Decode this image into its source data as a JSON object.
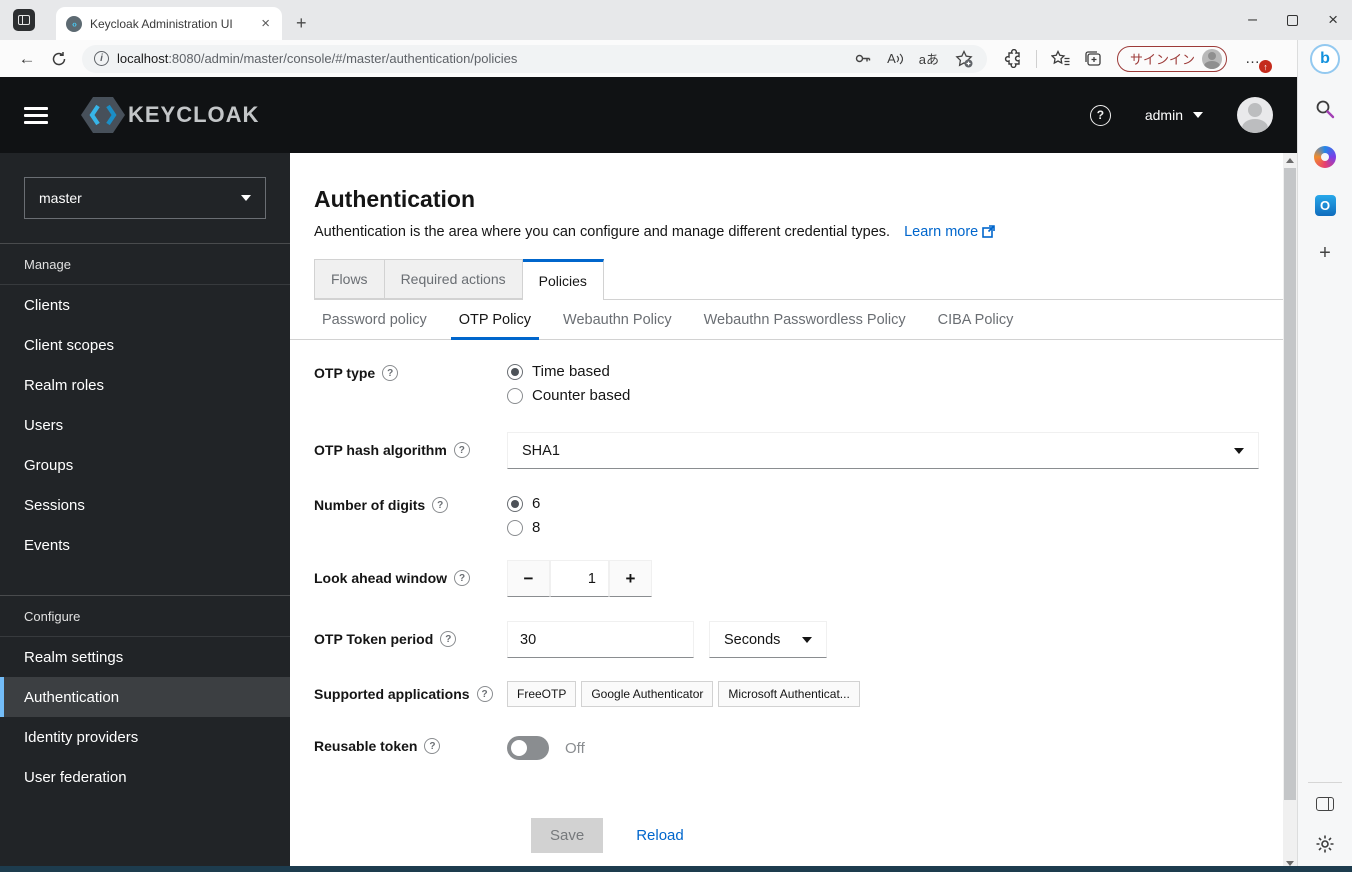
{
  "colors": {
    "accent_blue": "#0066cc",
    "selected_nav_blue": "#73bcf7",
    "masthead_bg": "#101214",
    "signin_red": "#9c3a38",
    "disabled_button_bg": "#d2d2d2"
  },
  "browser": {
    "tab_title": "Keycloak Administration UI",
    "url_host": "localhost",
    "url_rest": ":8080/admin/master/console/#/master/authentication/policies",
    "signin_label": "サインイン"
  },
  "glyphs": {
    "close": "×",
    "plus": "+",
    "minimize": "–",
    "back": "←",
    "question": "?",
    "info": "i",
    "minus": "−",
    "ellipsis": "…",
    "read_aloud": "A",
    "translate": "aあ",
    "update_arrow": "↑",
    "bing_b": "b",
    "outlook_o": "O",
    "favicon_marks": "‹›"
  },
  "masthead": {
    "brand": "KEYCLOAK",
    "username": "admin"
  },
  "sidebar": {
    "realm": "master",
    "groups": [
      {
        "label": "Manage",
        "items": [
          "Clients",
          "Client scopes",
          "Realm roles",
          "Users",
          "Groups",
          "Sessions",
          "Events"
        ]
      },
      {
        "label": "Configure",
        "items": [
          "Realm settings",
          "Authentication",
          "Identity providers",
          "User federation"
        ],
        "active_item": "Authentication"
      }
    ]
  },
  "page": {
    "title": "Authentication",
    "description": "Authentication is the area where you can configure and manage different credential types.",
    "learn_more": "Learn more",
    "tabs": [
      "Flows",
      "Required actions",
      "Policies"
    ],
    "active_tab": "Policies",
    "subtabs": [
      "Password policy",
      "OTP Policy",
      "Webauthn Policy",
      "Webauthn Passwordless Policy",
      "CIBA Policy"
    ],
    "active_subtab": "OTP Policy"
  },
  "form": {
    "otp_type": {
      "label": "OTP type",
      "options": [
        "Time based",
        "Counter based"
      ],
      "selected": "Time based"
    },
    "hash": {
      "label": "OTP hash algorithm",
      "value": "SHA1"
    },
    "digits": {
      "label": "Number of digits",
      "options": [
        "6",
        "8"
      ],
      "selected": "6"
    },
    "look_ahead": {
      "label": "Look ahead window",
      "value": "1"
    },
    "token_period": {
      "label": "OTP Token period",
      "value": "30",
      "unit": "Seconds"
    },
    "supported_apps": {
      "label": "Supported applications",
      "chips": [
        "FreeOTP",
        "Google Authenticator",
        "Microsoft Authenticat..."
      ]
    },
    "reusable": {
      "label": "Reusable token",
      "state": "Off"
    },
    "save_label": "Save",
    "reload_label": "Reload"
  }
}
